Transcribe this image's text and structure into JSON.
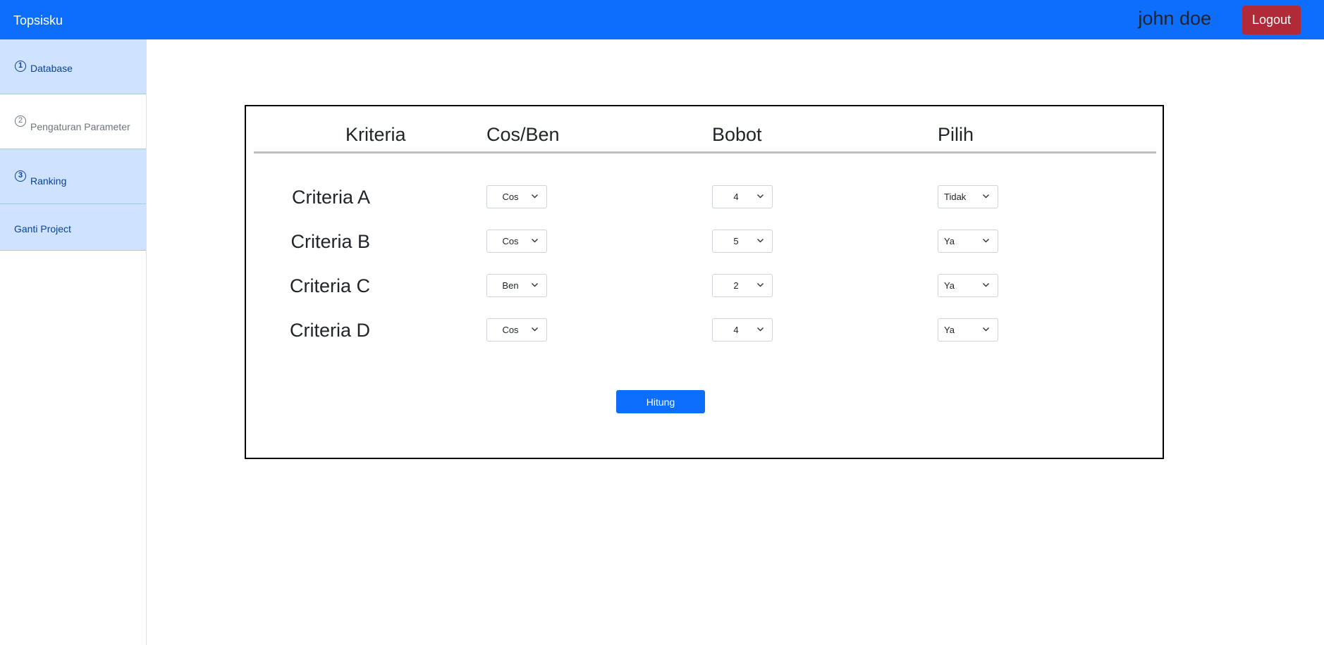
{
  "navbar": {
    "brand": "Topsisku",
    "user_name": "john doe",
    "logout_label": "Logout"
  },
  "sidebar": {
    "items": [
      {
        "num": "1",
        "label": "Database",
        "active": true
      },
      {
        "num": "2",
        "label": "Pengaturan Parameter",
        "active": false
      },
      {
        "num": "3",
        "label": "Ranking",
        "active": true
      },
      {
        "num": "",
        "label": "Ganti Project",
        "active": true
      }
    ]
  },
  "table": {
    "headers": [
      "Kriteria",
      "Cos/Ben",
      "Bobot",
      "Pilih"
    ],
    "rows": [
      {
        "name": "Criteria A",
        "cosben": "Cos",
        "bobot": "4",
        "pilih": "Tidak"
      },
      {
        "name": "Criteria B",
        "cosben": "Cos",
        "bobot": "5",
        "pilih": "Ya"
      },
      {
        "name": "Criteria C",
        "cosben": "Ben",
        "bobot": "2",
        "pilih": "Ya"
      },
      {
        "name": "Criteria D",
        "cosben": "Cos",
        "bobot": "4",
        "pilih": "Ya"
      }
    ]
  },
  "actions": {
    "hitung_label": "Hitung"
  },
  "colors": {
    "primary": "#0d6efd",
    "danger": "#b02a37",
    "sidebar_active": "#cfe2ff"
  }
}
